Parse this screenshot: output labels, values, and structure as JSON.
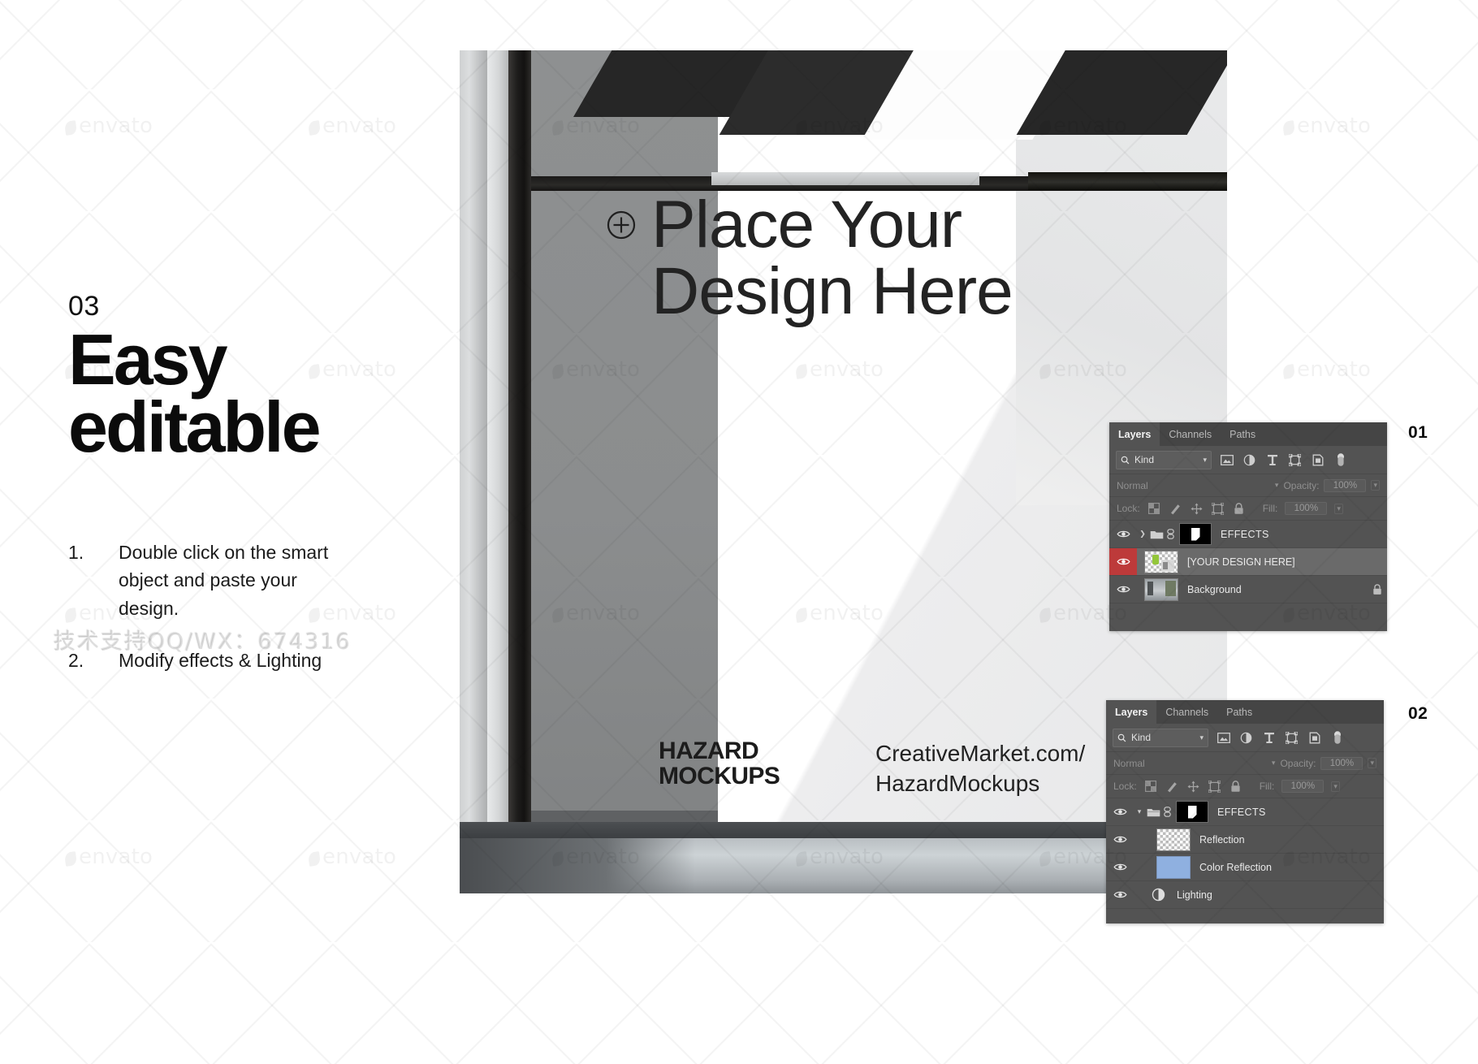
{
  "left": {
    "kicker": "03",
    "headline_line1": "Easy",
    "headline_line2": "editable",
    "steps": [
      {
        "num": "1.",
        "text": "Double click on the smart object and paste your design."
      },
      {
        "num": "2.",
        "text": "Modify effects & Lighting"
      }
    ],
    "support_watermark": "技术支持QQ/WX：674316"
  },
  "photo": {
    "placeholder_line1": "Place Your",
    "placeholder_line2": "Design Here",
    "plus_icon": "plus-circle-icon",
    "logo_line1": "HAZARD",
    "logo_line2": "MOCKUPS",
    "url_line1": "CreativeMarket.com/",
    "url_line2": "HazardMockups"
  },
  "watermark": {
    "brand": "envato"
  },
  "panels": [
    {
      "number": "01",
      "tabs": [
        {
          "label": "Layers",
          "active": true
        },
        {
          "label": "Channels",
          "active": false
        },
        {
          "label": "Paths",
          "active": false
        }
      ],
      "filter": {
        "kind_label": "Kind",
        "search_icon": "magnifier-icon",
        "caret_icon": "chevron-down-icon",
        "icons": [
          "image-filter-icon",
          "adjustment-filter-icon",
          "type-filter-icon",
          "shape-filter-icon",
          "smart-object-filter-icon",
          "pixel-filter-icon"
        ]
      },
      "blend": {
        "mode": "Normal",
        "opacity_label": "Opacity:",
        "opacity_value": "100%"
      },
      "lock": {
        "label": "Lock:",
        "fill_label": "Fill:",
        "fill_value": "100%",
        "icons": [
          "lock-transparency-icon",
          "lock-image-icon",
          "lock-position-icon",
          "lock-artboard-icon",
          "lock-all-icon"
        ]
      },
      "layers": [
        {
          "name": "EFFECTS",
          "type": "group",
          "visible": true,
          "expanded": false,
          "selected": false,
          "thumb": "mask",
          "locked": false
        },
        {
          "name": "[YOUR DESIGN HERE]",
          "type": "smart-object",
          "visible": true,
          "selected": true,
          "thumb": "design",
          "locked": false
        },
        {
          "name": "Background",
          "type": "image",
          "visible": true,
          "selected": false,
          "thumb": "background",
          "locked": true
        }
      ]
    },
    {
      "number": "02",
      "tabs": [
        {
          "label": "Layers",
          "active": true
        },
        {
          "label": "Channels",
          "active": false
        },
        {
          "label": "Paths",
          "active": false
        }
      ],
      "filter": {
        "kind_label": "Kind",
        "search_icon": "magnifier-icon",
        "caret_icon": "chevron-down-icon",
        "icons": [
          "image-filter-icon",
          "adjustment-filter-icon",
          "type-filter-icon",
          "shape-filter-icon",
          "smart-object-filter-icon",
          "pixel-filter-icon"
        ]
      },
      "blend": {
        "mode": "Normal",
        "opacity_label": "Opacity:",
        "opacity_value": "100%"
      },
      "lock": {
        "label": "Lock:",
        "fill_label": "Fill:",
        "fill_value": "100%",
        "icons": [
          "lock-transparency-icon",
          "lock-image-icon",
          "lock-position-icon",
          "lock-artboard-icon",
          "lock-all-icon"
        ]
      },
      "layers": [
        {
          "name": "EFFECTS",
          "type": "group",
          "visible": true,
          "expanded": true,
          "selected": false,
          "thumb": "mask",
          "locked": false
        },
        {
          "name": "Reflection",
          "type": "pixel",
          "visible": true,
          "selected": false,
          "thumb": "checker",
          "locked": false
        },
        {
          "name": "Color Reflection",
          "type": "pixel",
          "visible": true,
          "selected": false,
          "thumb": "color",
          "locked": false
        },
        {
          "name": "Lighting",
          "type": "adjustment",
          "visible": true,
          "selected": false,
          "thumb": "adjustment",
          "locked": false
        }
      ]
    }
  ],
  "colors": {
    "panel_bg": "#535353",
    "panel_tabbar": "#454545",
    "selected_row": "#6a6a6a",
    "visibility_alert": "#bd3a3a",
    "color_reflection_swatch": "#8fb0e0",
    "text_primary": "#0b0b0b"
  }
}
